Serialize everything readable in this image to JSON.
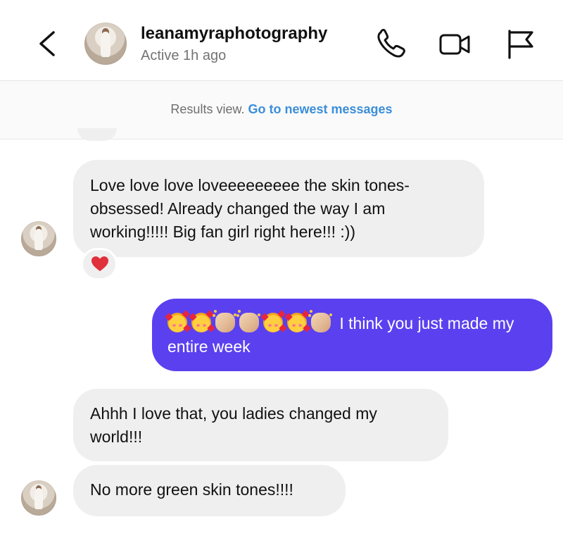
{
  "header": {
    "username": "leanamyraphotography",
    "status": "Active 1h ago",
    "icons": [
      "back-chevron-icon",
      "phone-icon",
      "video-camera-icon",
      "flag-icon"
    ]
  },
  "banner": {
    "text": "Results view.",
    "link": "Go to newest messages"
  },
  "messages": [
    {
      "sender": "them",
      "text": "Love love love loveeeeeeeee the skin tones-obsessed! Already changed the way I am working!!!!! Big fan girl right here!!! :))",
      "reaction": "red-heart-icon"
    },
    {
      "sender": "me",
      "emojis": [
        "smiling-face-with-hearts-icon",
        "smiling-face-with-hearts-icon",
        "clapping-hands-icon",
        "clapping-hands-icon",
        "smiling-face-with-hearts-icon",
        "smiling-face-with-hearts-icon",
        "clapping-hands-icon"
      ],
      "text": "I think you just made my entire week"
    },
    {
      "sender": "them",
      "text": "Ahhh I love that, you ladies changed my world!!!"
    },
    {
      "sender": "them",
      "text": "No more green skin tones!!!!"
    }
  ],
  "colors": {
    "outgoing_bubble": "#5b40f0",
    "incoming_bubble": "#efefef",
    "link": "#3b8ed8",
    "reaction_heart": "#e0303b"
  }
}
